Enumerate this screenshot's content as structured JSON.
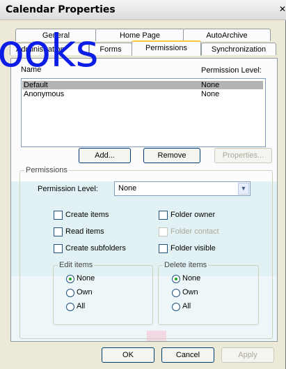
{
  "window": {
    "title": "Calendar Properties",
    "close_glyph": "✕"
  },
  "tabs_row1": [
    "General",
    "Home Page",
    "AutoArchive"
  ],
  "tabs_row2": [
    "Administration",
    "Forms",
    "Permissions",
    "Synchronization"
  ],
  "active_tab": "Permissions",
  "overlay_text": "ooks",
  "list": {
    "col_name": "Name",
    "col_level": "Permission Level:",
    "rows": [
      {
        "name": "Default",
        "level": "None",
        "selected": true
      },
      {
        "name": "Anonymous",
        "level": "None",
        "selected": false
      }
    ]
  },
  "buttons": {
    "add": "Add...",
    "remove": "Remove",
    "properties": "Properties...",
    "ok": "OK",
    "cancel": "Cancel",
    "apply": "Apply"
  },
  "permissions": {
    "group_title": "Permissions",
    "level_label": "Permission Level:",
    "level_value": "None",
    "checks": {
      "create_items": "Create items",
      "read_items": "Read items",
      "create_subfolders": "Create subfolders",
      "folder_owner": "Folder owner",
      "folder_contact": "Folder contact",
      "folder_visible": "Folder visible"
    },
    "edit_items": {
      "title": "Edit items",
      "options": [
        "None",
        "Own",
        "All"
      ],
      "selected": "None"
    },
    "delete_items": {
      "title": "Delete items",
      "options": [
        "None",
        "Own",
        "All"
      ],
      "selected": "None"
    }
  },
  "colors": {
    "decor_teal": "#d8eef2",
    "decor_pink": "#f3d7e4",
    "overlay_blue": "#0c1de8"
  }
}
